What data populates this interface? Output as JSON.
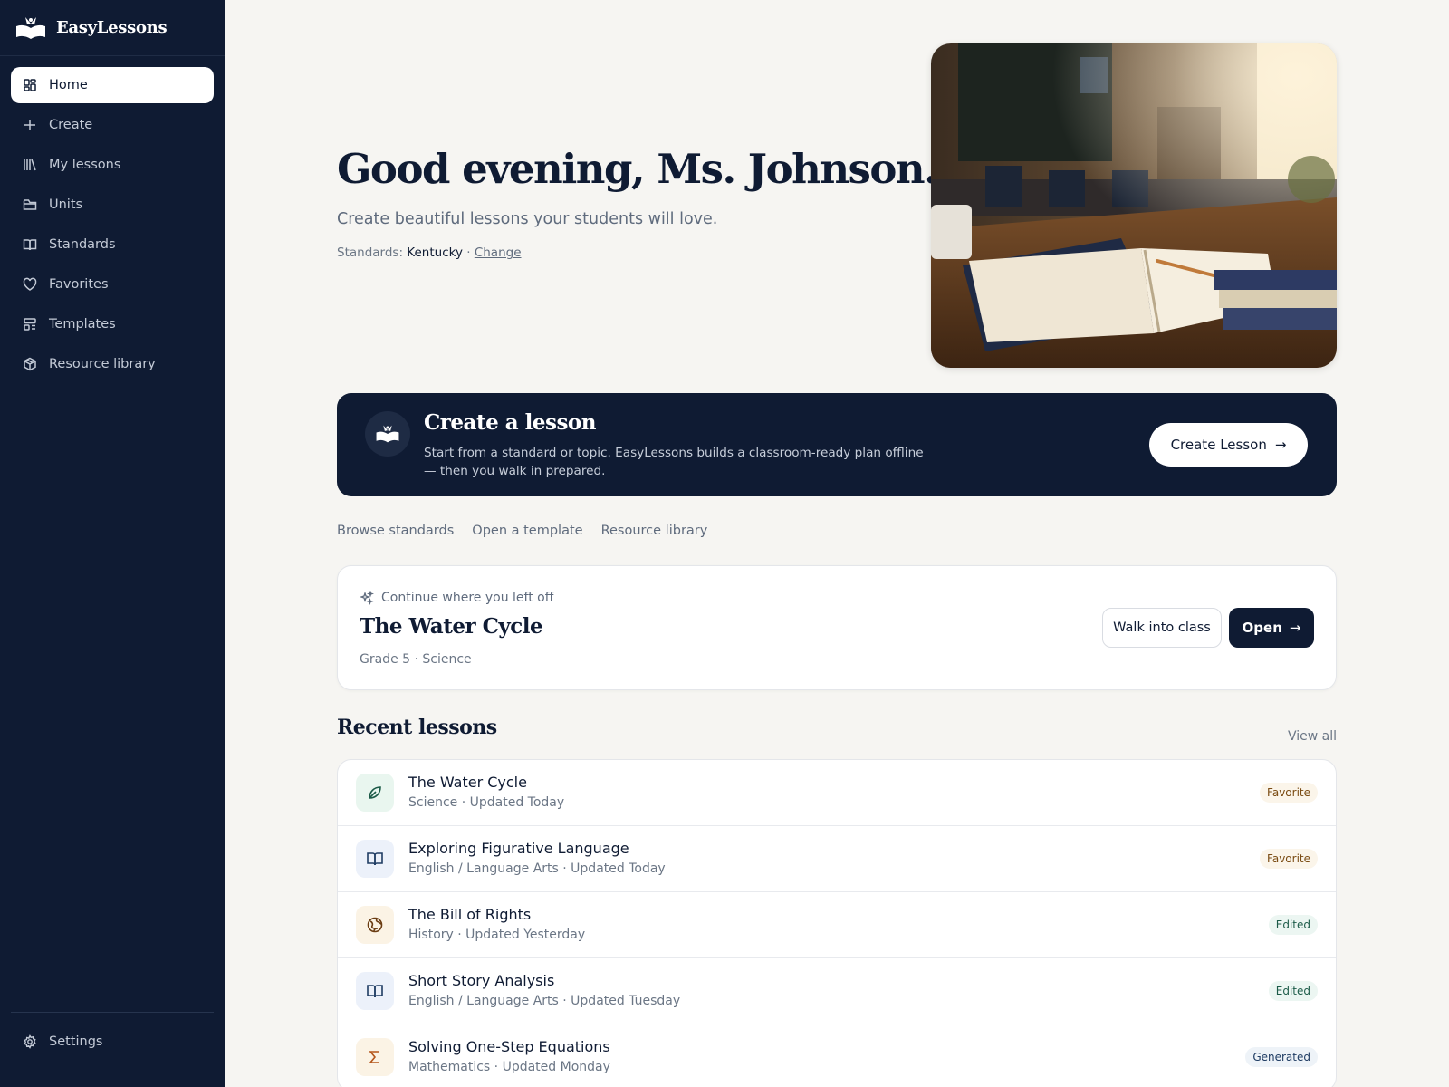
{
  "brand": {
    "name": "EasyLessons",
    "icon": "book-logo-icon"
  },
  "nav": {
    "items": [
      {
        "label": "Home",
        "icon": "grid-icon"
      },
      {
        "label": "Create",
        "icon": "plus-icon"
      },
      {
        "label": "My lessons",
        "icon": "library-icon"
      },
      {
        "label": "Units",
        "icon": "folder-icon"
      },
      {
        "label": "Standards",
        "icon": "book-open-icon"
      },
      {
        "label": "Favorites",
        "icon": "heart-icon"
      },
      {
        "label": "Templates",
        "icon": "layout-icon"
      },
      {
        "label": "Resource library",
        "icon": "package-icon"
      }
    ],
    "settings": {
      "label": "Settings",
      "icon": "gear-icon"
    }
  },
  "hero": {
    "greeting": "Good evening, Ms. Johnson.",
    "subtitle": "Create beautiful lessons your students will love.",
    "standards_label": "Standards:",
    "standards_state": "Kentucky",
    "separator": "·",
    "change_label": "Change"
  },
  "cta": {
    "title": "Create a lesson",
    "description": "Start from a standard or topic. EasyLessons builds a classroom-ready plan offline — then you walk in prepared.",
    "button": "Create Lesson"
  },
  "quick_links": [
    "Browse standards",
    "Open a template",
    "Resource library"
  ],
  "continue": {
    "label": "Continue where you left off",
    "title": "The Water Cycle",
    "meta": "Grade 5 · Science",
    "walk_button": "Walk into class",
    "open_button": "Open"
  },
  "recent": {
    "title": "Recent lessons",
    "view_all": "View all",
    "lessons": [
      {
        "title": "The Water Cycle",
        "meta": "Science · Updated Today",
        "badge": "Favorite",
        "icon": "leaf-icon"
      },
      {
        "title": "Exploring Figurative Language",
        "meta": "English / Language Arts · Updated Today",
        "badge": "Favorite",
        "icon": "book-open-icon"
      },
      {
        "title": "The Bill of Rights",
        "meta": "History · Updated Yesterday",
        "badge": "Edited",
        "icon": "globe-icon"
      },
      {
        "title": "Short Story Analysis",
        "meta": "English / Language Arts · Updated Tuesday",
        "badge": "Edited",
        "icon": "book-open-icon"
      },
      {
        "title": "Solving One-Step Equations",
        "meta": "Mathematics · Updated Monday",
        "badge": "Generated",
        "icon": "sigma-icon"
      }
    ]
  },
  "colors": {
    "navy": "#0f1b33",
    "background": "#f6f5f2",
    "muted": "#6b7685"
  }
}
